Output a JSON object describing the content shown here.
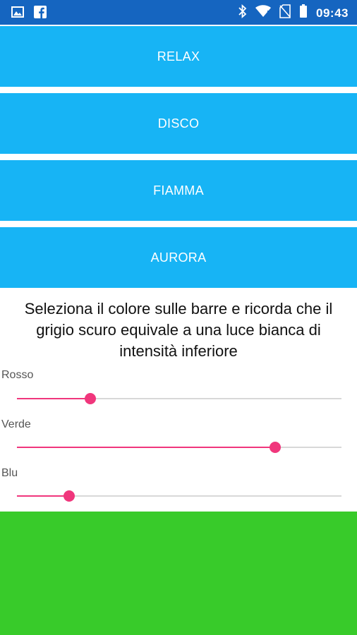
{
  "status_bar": {
    "time": "09:43",
    "left_icons": [
      "image-icon",
      "facebook-icon"
    ],
    "right_icons": [
      "bluetooth-icon",
      "wifi-icon",
      "no-sim-icon",
      "battery-icon"
    ]
  },
  "modes": [
    {
      "label": "RELAX"
    },
    {
      "label": "DISCO"
    },
    {
      "label": "FIAMMA"
    },
    {
      "label": "AURORA"
    }
  ],
  "instructions": "Seleziona il colore sulle barre e ricorda che il grigio scuro equivale a una luce bianca di intensità inferiore",
  "sliders": {
    "red": {
      "label": "Rosso",
      "value": 0.225
    },
    "green": {
      "label": "Verde",
      "value": 0.795
    },
    "blue": {
      "label": "Blu",
      "value": 0.16
    }
  },
  "colors": {
    "status_bar": "#1565c0",
    "mode_button": "#17b4f5",
    "accent": "#f0367c",
    "preview": "#38cb2a"
  }
}
